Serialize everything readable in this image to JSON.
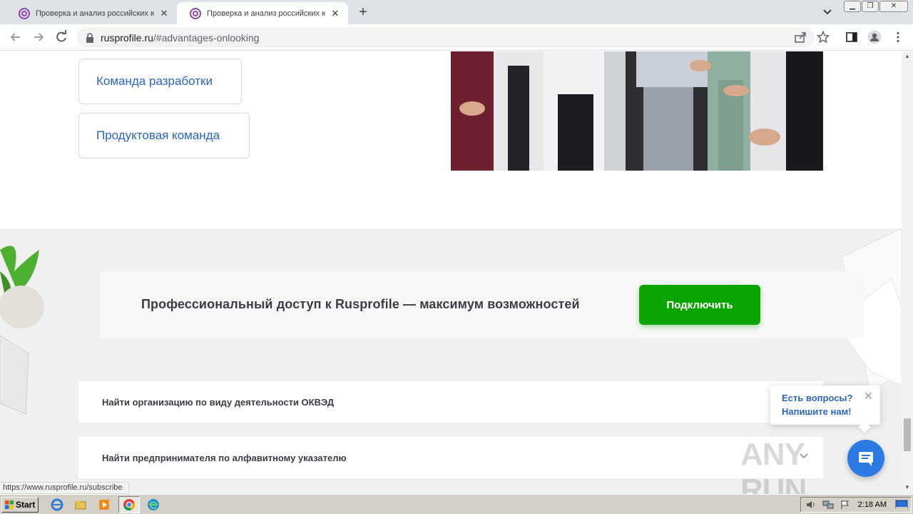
{
  "browser": {
    "tabs": [
      {
        "title": "Проверка и анализ российских юр",
        "active": false
      },
      {
        "title": "Проверка и анализ российских юр",
        "active": true
      }
    ],
    "url_host": "rusprofile.ru",
    "url_path": "/#advantages-onlooking",
    "status_url": "https://www.rusprofile.ru/subscribe"
  },
  "page": {
    "team_buttons": [
      "Команда разработки",
      "Продуктовая команда"
    ],
    "cta_text": "Профессиональный доступ к Rusprofile — максимум возможностей",
    "cta_button": "Подключить",
    "accordion": [
      "Найти организацию по виду деятельности ОКВЭД",
      "Найти предпринимателя по алфавитному указателю"
    ],
    "chat": {
      "line1": "Есть вопросы?",
      "line2": "Напишите нам!"
    },
    "watermark": "ANY RUN"
  },
  "taskbar": {
    "start_label": "Start",
    "clock": "2:18 AM"
  },
  "colors": {
    "accent_blue": "#2a64c8",
    "cta_green": "#0ca400",
    "chat_blue": "#2c7be5"
  }
}
